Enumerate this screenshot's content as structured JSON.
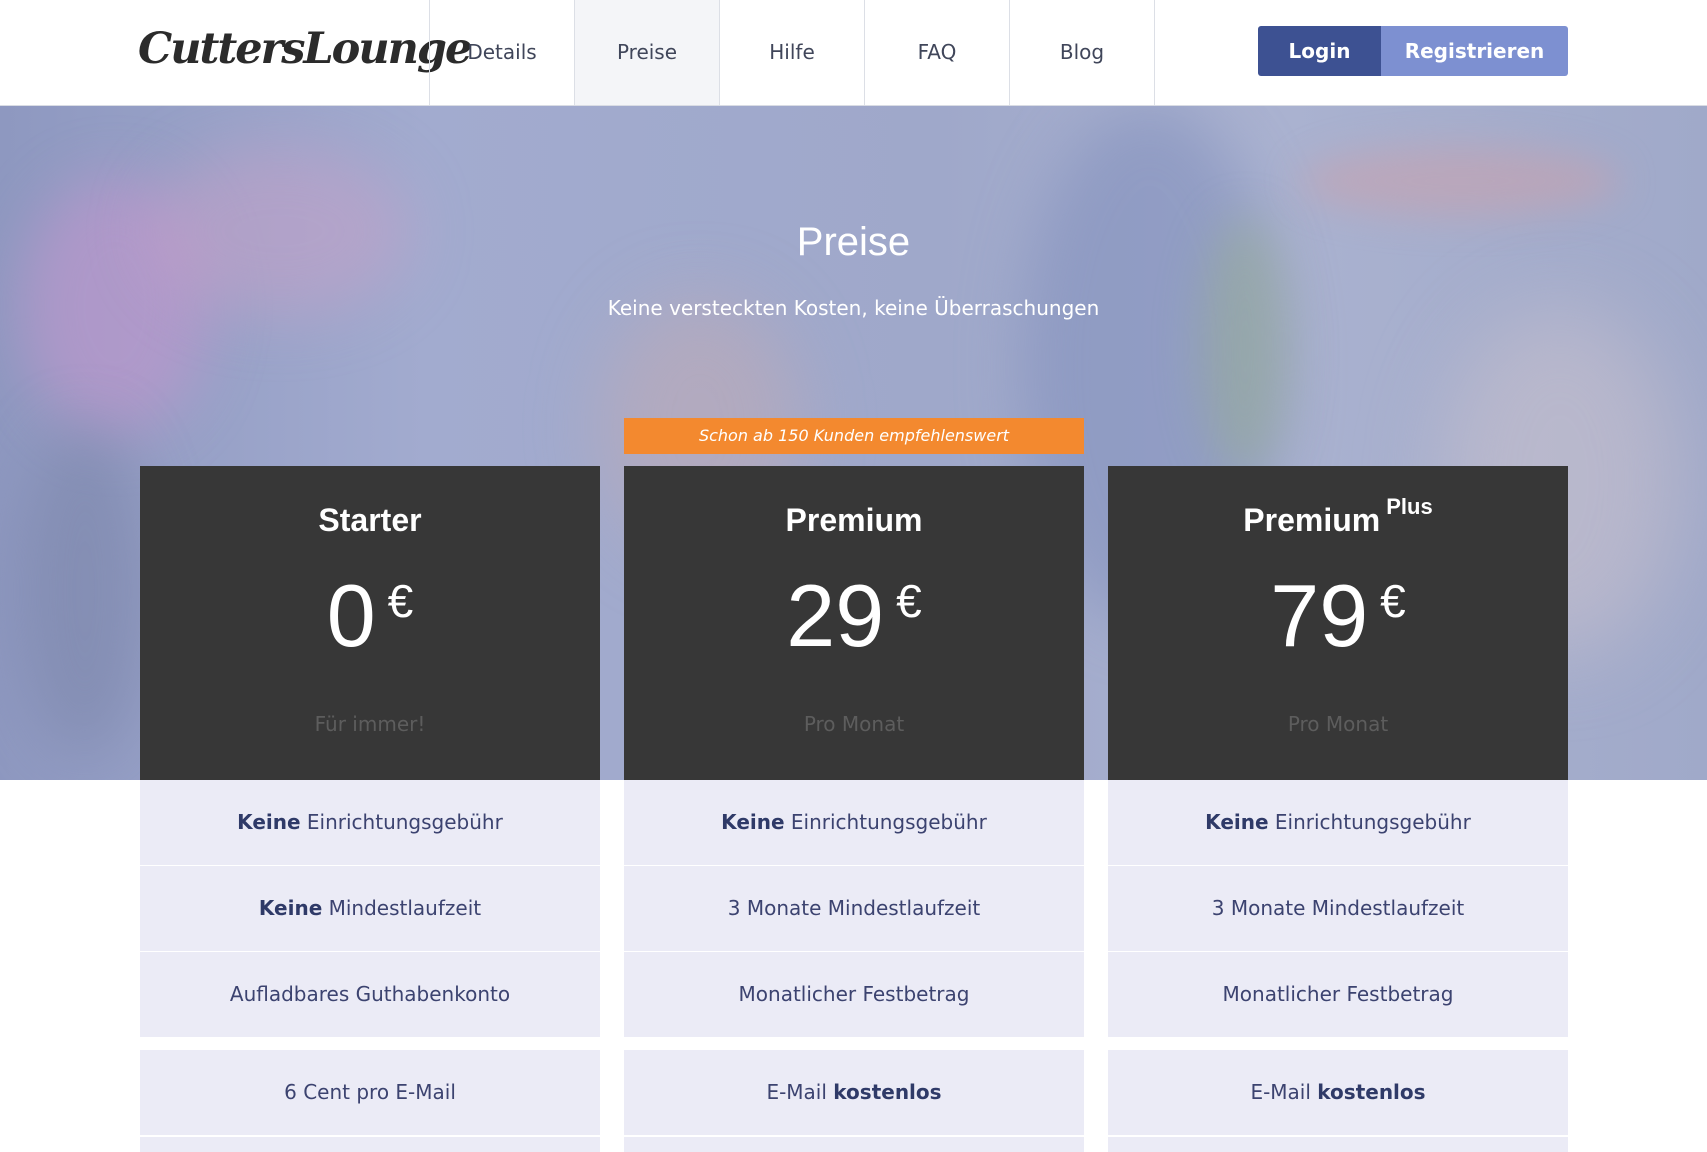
{
  "header": {
    "logo": "CuttersLounge",
    "nav": [
      "Details",
      "Preise",
      "Hilfe",
      "FAQ",
      "Blog"
    ],
    "active_nav": "Preise",
    "login_label": "Login",
    "register_label": "Registrieren"
  },
  "hero": {
    "title": "Preise",
    "subtitle": "Keine versteckten Kosten, keine Überraschungen"
  },
  "plans": [
    {
      "name": "Starter",
      "name_sup": "",
      "price": "0",
      "currency": "€",
      "period": "Für immer!",
      "features": [
        {
          "bold": "Keine",
          "text": " Einrichtungsgebühr"
        },
        {
          "bold": "Keine",
          "text": " Mindestlaufzeit"
        },
        {
          "bold": "",
          "text": "Aufladbares Guthabenkonto"
        },
        {
          "pre": "6 Cent pro E-Mail",
          "bold": ""
        }
      ]
    },
    {
      "name": "Premium",
      "name_sup": "",
      "banner": "Schon ab 150 Kunden empfehlenswert",
      "price": "29",
      "currency": "€",
      "period": "Pro Monat",
      "features": [
        {
          "bold": "Keine",
          "text": " Einrichtungsgebühr"
        },
        {
          "bold": "",
          "text": "3 Monate Mindestlaufzeit"
        },
        {
          "bold": "",
          "text": "Monatlicher Festbetrag"
        },
        {
          "pre": "E-Mail ",
          "bold": "kostenlos"
        }
      ]
    },
    {
      "name": "Premium",
      "name_sup": "Plus",
      "price": "79",
      "currency": "€",
      "period": "Pro Monat",
      "features": [
        {
          "bold": "Keine",
          "text": " Einrichtungsgebühr"
        },
        {
          "bold": "",
          "text": "3 Monate Mindestlaufzeit"
        },
        {
          "bold": "",
          "text": "Monatlicher Festbetrag"
        },
        {
          "pre": "E-Mail ",
          "bold": "kostenlos"
        }
      ]
    }
  ]
}
